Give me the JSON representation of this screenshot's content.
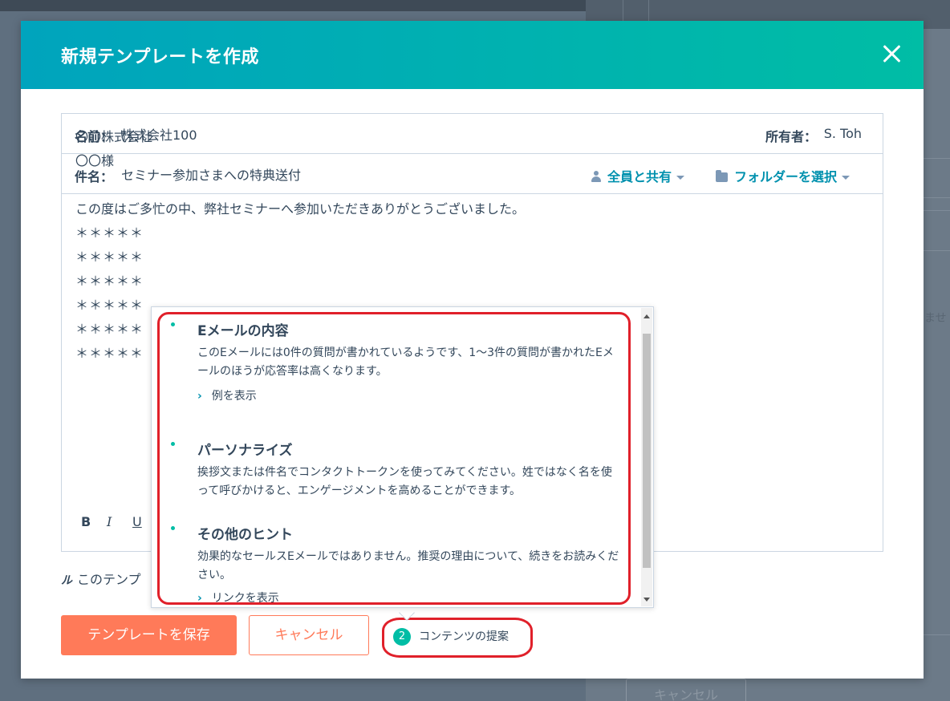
{
  "modal": {
    "title": "新規テンプレートを作成"
  },
  "fields": {
    "name_label": "名前：",
    "name_value": "株式会社100",
    "owner_label": "所有者：",
    "owner_value": "S. Toh",
    "subject_label": "件名：",
    "subject_value": "セミナー参加さまへの特典送付",
    "share_label": "全員と共有",
    "folder_label": "フォルダーを選択"
  },
  "body": {
    "line1": "〇〇株式会社",
    "line2": "〇〇様",
    "line3": "この度はご多忙の中、弊社セミナーへ参加いただきありがとうございました。",
    "stars1": "＊＊＊＊＊",
    "stars2": "＊＊＊＊＊",
    "stars3": "＊＊＊＊＊",
    "stars4": "＊＊＊＊＊",
    "stars5": "＊＊＊＊＊",
    "stars6": "＊＊＊＊＊"
  },
  "toolbar": {
    "bold": "B",
    "italic": "I",
    "underline": "U"
  },
  "signature_note": "このテンプ",
  "buttons": {
    "save": "テンプレートを保存",
    "cancel": "キャンセル"
  },
  "suggestions": {
    "count": "2",
    "label": "コンテンツの提案"
  },
  "tips": [
    {
      "title": "Eメールの内容",
      "desc": "このEメールには0件の質問が書かれているようです、1〜3件の質問が書かれたEメールのほうが応答率は高くなります。",
      "link": "例を表示"
    },
    {
      "title": "パーソナライズ",
      "desc": "挨拶文または件名でコンタクトトークンを使ってみてください。姓ではなく名を使って呼びかけると、エンゲージメントを高めることができます。"
    },
    {
      "title": "その他のヒント",
      "desc": "効果的なセールスEメールではありません。推奨の理由について、続きをお読みください。",
      "link": "リンクを表示"
    }
  ],
  "background": {
    "cancel_button": "キャンセル",
    "text_fragment": "ませ"
  },
  "colors": {
    "header_start": "#00a4bd",
    "header_end": "#00bda5",
    "primary_button": "#ff7a59",
    "link": "#0091ae",
    "text": "#33475b",
    "highlight": "#e0202a"
  }
}
